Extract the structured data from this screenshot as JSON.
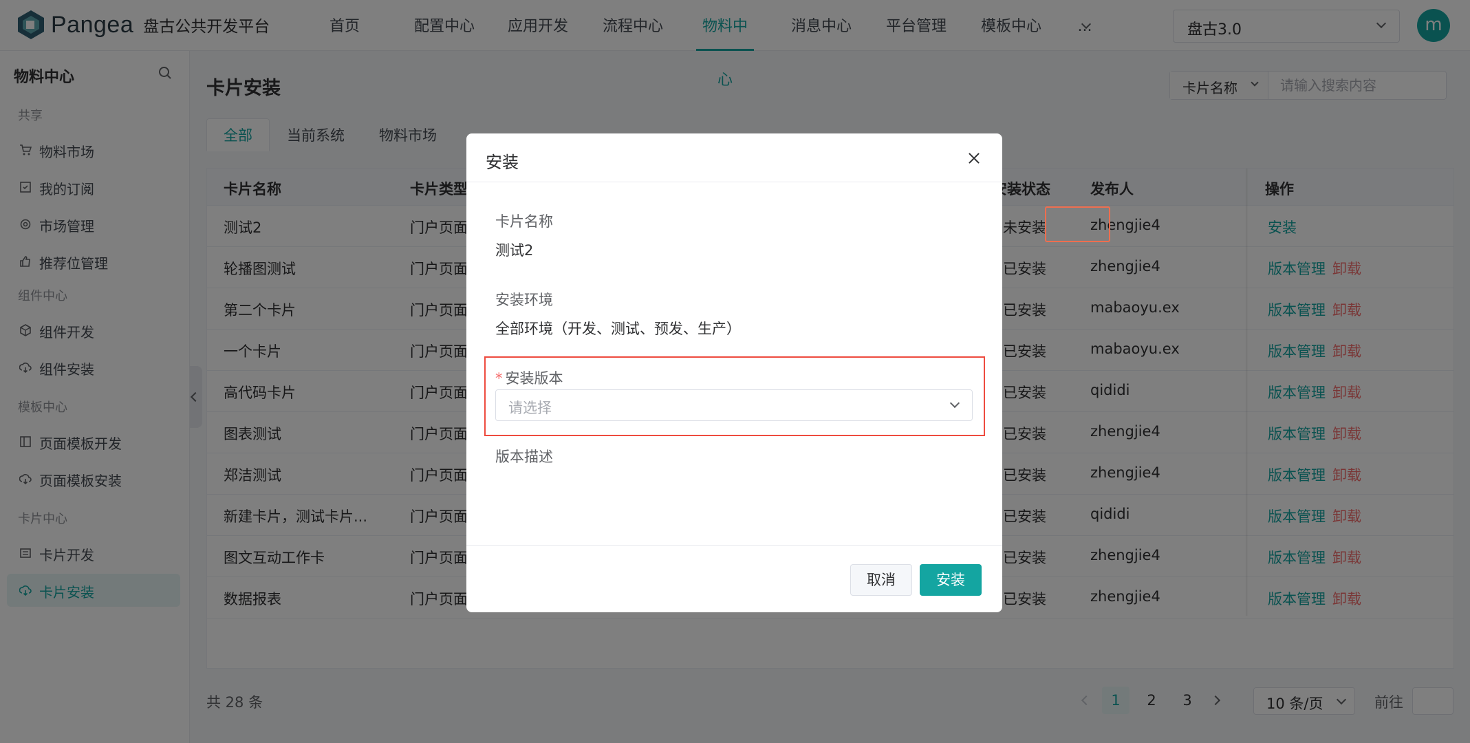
{
  "header": {
    "brand": "Pangea",
    "brand_sub": "盘古公共开发平台",
    "nav": [
      "首页",
      "配置中心",
      "应用开发",
      "流程中心",
      "物料中心",
      "消息中心",
      "平台管理",
      "模板中心",
      "..."
    ],
    "active_nav": "物料中心",
    "version": "盘古3.0",
    "avatar": "m"
  },
  "sidebar": {
    "title": "物料中心",
    "groups": {
      "share": "共享",
      "component": "组件中心",
      "template": "模板中心",
      "card": "卡片中心"
    },
    "items": {
      "market": "物料市场",
      "subscribe": "我的订阅",
      "market_mgmt": "市场管理",
      "recommend": "推荐位管理",
      "comp_dev": "组件开发",
      "comp_install": "组件安装",
      "tpl_dev": "页面模板开发",
      "tpl_install": "页面模板安装",
      "card_dev": "卡片开发",
      "card_install": "卡片安装"
    }
  },
  "main": {
    "title": "卡片安装",
    "search_field": "卡片名称",
    "search_placeholder": "请输入搜索内容",
    "tabs": [
      "全部",
      "当前系统",
      "物料市场"
    ],
    "columns": {
      "name": "卡片名称",
      "type": "卡片类型",
      "status": "安装状态",
      "publisher": "发布人",
      "ops": "操作"
    },
    "rows": [
      {
        "name": "测试2",
        "type": "门户页面",
        "status": "未安装",
        "publisher": "zhengjie4"
      },
      {
        "name": "轮播图测试",
        "type": "门户页面",
        "status": "已安装",
        "publisher": "zhengjie4"
      },
      {
        "name": "第二个卡片",
        "type": "门户页面",
        "status": "已安装",
        "publisher": "mabaoyu.ex"
      },
      {
        "name": "一个卡片",
        "type": "门户页面",
        "status": "已安装",
        "publisher": "mabaoyu.ex"
      },
      {
        "name": "高代码卡片",
        "type": "门户页面",
        "status": "已安装",
        "publisher": "qididi"
      },
      {
        "name": "图表测试",
        "type": "门户页面",
        "status": "已安装",
        "publisher": "zhengjie4"
      },
      {
        "name": "郑洁测试",
        "type": "门户页面",
        "status": "已安装",
        "publisher": "zhengjie4"
      },
      {
        "name": "新建卡片，测试卡片...",
        "type": "门户页面",
        "status": "已安装",
        "publisher": "qididi"
      },
      {
        "name": "图文互动工作卡",
        "type": "门户页面",
        "status": "已安装",
        "publisher": "zhengjie4"
      },
      {
        "name": "数据报表",
        "type": "门户页面",
        "status": "已安装",
        "publisher": "zhengjie4"
      }
    ],
    "op_install": "安装",
    "op_version": "版本管理",
    "op_uninstall": "卸载",
    "total": "共 28 条",
    "pages": [
      "1",
      "2",
      "3"
    ],
    "page_size": "10 条/页",
    "goto": "前往"
  },
  "dialog": {
    "title": "安装",
    "name_label": "卡片名称",
    "name_value": "测试2",
    "env_label": "安装环境",
    "env_value": "全部环境（开发、测试、预发、生产）",
    "version_label": "安装版本",
    "version_placeholder": "请选择",
    "desc_label": "版本描述",
    "cancel": "取消",
    "ok": "安装"
  },
  "colors": {
    "primary": "#14a5a1",
    "danger": "#f56c6c",
    "highlight": "#ee4b3f"
  }
}
